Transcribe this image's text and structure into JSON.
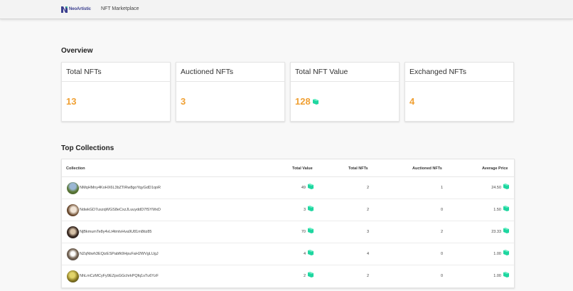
{
  "header": {
    "logo_text": "NeoArtistic",
    "nav_link": "NFT Marketplace"
  },
  "overview": {
    "title": "Overview",
    "cards": [
      {
        "label": "Total NFTs",
        "value": "13",
        "coin": false
      },
      {
        "label": "Auctioned NFTs",
        "value": "3",
        "coin": false
      },
      {
        "label": "Total NFT Value",
        "value": "128",
        "coin": true
      },
      {
        "label": "Exchanged NFTs",
        "value": "4",
        "coin": false
      }
    ]
  },
  "top_collections": {
    "title": "Top Collections",
    "columns": [
      "Collection",
      "Total Value",
      "Total NFTs",
      "Auctioned NFTs",
      "Average Price"
    ],
    "rows": [
      {
        "collection": "NMqHMny4KoHX6L3bZTiRw8goYqyGdD1qoR",
        "total_value": "49",
        "total_nfts": "2",
        "auctioned_nfts": "1",
        "average_price": "24.50"
      },
      {
        "collection": "NdwkGD7uszqWGS8eCxzJLuuyddD7fSYWxD",
        "total_value": "3",
        "total_nfts": "2",
        "auctioned_nfts": "0",
        "average_price": "1.50"
      },
      {
        "collection": "NjBkmumTe8y4vLt4tmtvHva9U81m8tiz85",
        "total_value": "70",
        "total_nfts": "3",
        "auctioned_nfts": "2",
        "average_price": "23.33"
      },
      {
        "collection": "NZqNtwh3EQizESPabfk9HpuFaH2WVgLUgJ",
        "total_value": "4",
        "total_nfts": "4",
        "auctioned_nfts": "0",
        "average_price": "1.00"
      },
      {
        "collection": "NhLmCzMCyFy9EZpsGGchrkPQfq1sTu6YzF",
        "total_value": "2",
        "total_nfts": "2",
        "auctioned_nfts": "0",
        "average_price": "1.00"
      }
    ]
  },
  "icons": {
    "logo": "neoartistic-logo-icon",
    "coin": "neo-coin-icon",
    "avatar": "collection-avatar-icon"
  },
  "colors": {
    "accent_value": "#f0a033",
    "coin": "#1fd6a0",
    "logo": "#3b3f8f"
  }
}
